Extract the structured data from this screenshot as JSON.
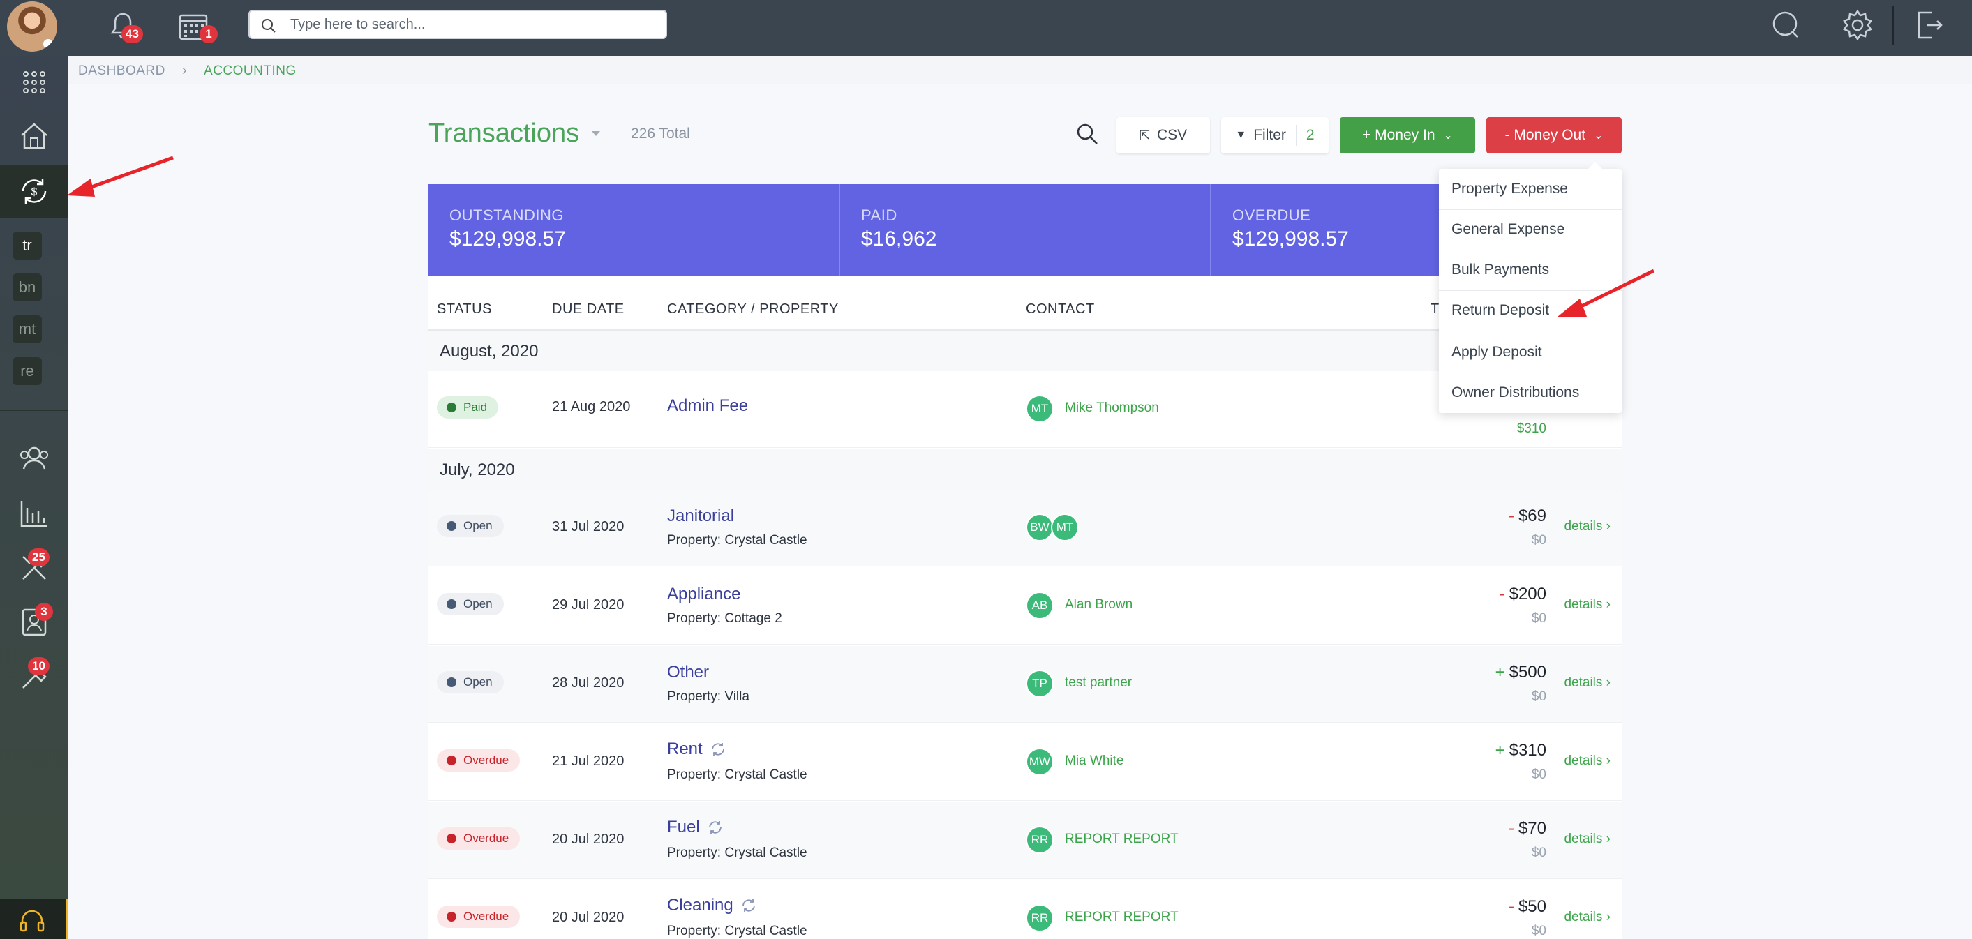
{
  "header": {
    "notifications_count": "43",
    "calendar_count": "1",
    "search_placeholder": "Type here to search..."
  },
  "sidebar": {
    "abbrs": [
      "tr",
      "bn",
      "mt",
      "re"
    ],
    "badges": {
      "maintenance": "25",
      "tenants": "3",
      "tools": "10"
    }
  },
  "breadcrumb": {
    "dashboard": "DASHBOARD",
    "current": "ACCOUNTING"
  },
  "page": {
    "title": "Transactions",
    "total": "226 Total",
    "csv_label": "CSV",
    "filter_label": "Filter",
    "filter_count": "2",
    "money_in_label": "+ Money In",
    "money_out_label": "- Money Out"
  },
  "stats": [
    {
      "label": "OUTSTANDING",
      "value": "$129,998.57"
    },
    {
      "label": "PAID",
      "value": "$16,962"
    },
    {
      "label": "OVERDUE",
      "value": "$129,998.57"
    }
  ],
  "table": {
    "headers": {
      "status": "STATUS",
      "due_date": "DUE DATE",
      "category": "CATEGORY / PROPERTY",
      "contact": "CONTACT",
      "total": "T"
    },
    "groups": [
      "August, 2020",
      "July, 2020"
    ],
    "rows": [
      {
        "status": "Paid",
        "due": "21 Aug 2020",
        "category": "Admin Fee",
        "property": "",
        "contacts": [
          "MT"
        ],
        "contact_name": "Mike Thompson",
        "sign": "",
        "amount": "",
        "paid": "$310",
        "details": ""
      },
      {
        "status": "Open",
        "due": "31 Jul 2020",
        "category": "Janitorial",
        "property": "Property: Crystal Castle",
        "contacts": [
          "BW",
          "MT"
        ],
        "contact_name": "",
        "sign": "-",
        "amount": "$69",
        "paid": "$0",
        "details": "details ›"
      },
      {
        "status": "Open",
        "due": "29 Jul 2020",
        "category": "Appliance",
        "property": "Property: Cottage 2",
        "contacts": [
          "AB"
        ],
        "contact_name": "Alan Brown",
        "sign": "-",
        "amount": "$200",
        "paid": "$0",
        "details": "details ›"
      },
      {
        "status": "Open",
        "due": "28 Jul 2020",
        "category": "Other",
        "property": "Property: Villa",
        "contacts": [
          "TP"
        ],
        "contact_name": "test partner",
        "sign": "+",
        "amount": "$500",
        "paid": "$0",
        "details": "details ›"
      },
      {
        "status": "Overdue",
        "due": "21 Jul 2020",
        "category": "Rent",
        "property": "Property: Crystal Castle",
        "contacts": [
          "MW"
        ],
        "contact_name": "Mia White",
        "sign": "+",
        "amount": "$310",
        "paid": "$0",
        "details": "details ›"
      },
      {
        "status": "Overdue",
        "due": "20 Jul 2020",
        "category": "Fuel",
        "property": "Property: Crystal Castle",
        "contacts": [
          "RR"
        ],
        "contact_name": "REPORT REPORT",
        "sign": "-",
        "amount": "$70",
        "paid": "$0",
        "details": "details ›"
      },
      {
        "status": "Overdue",
        "due": "20 Jul 2020",
        "category": "Cleaning",
        "property": "Property: Crystal Castle",
        "contacts": [
          "RR"
        ],
        "contact_name": "REPORT REPORT",
        "sign": "-",
        "amount": "$50",
        "paid": "$0",
        "details": "details ›"
      }
    ]
  },
  "money_out_menu": [
    "Property Expense",
    "General Expense",
    "Bulk Payments",
    "Return Deposit",
    "Apply Deposit",
    "Owner Distributions"
  ],
  "colors": {
    "accent_green": "#43a047",
    "danger_red": "#dc3f46",
    "stats_purple": "#6163e3",
    "topbar": "#3b4550"
  }
}
